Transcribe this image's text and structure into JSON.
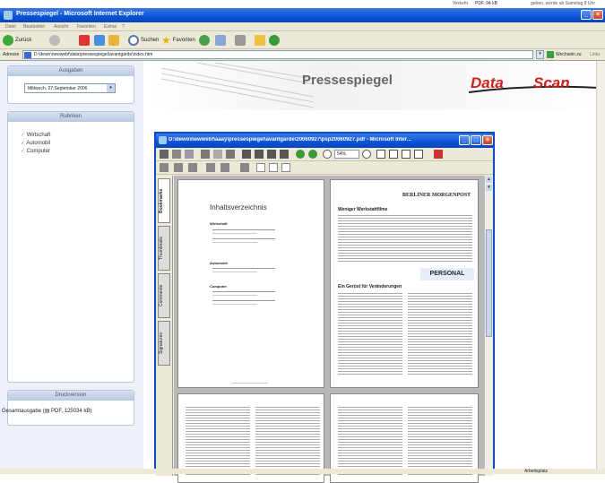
{
  "popup": {
    "verkehr": "Verkehr",
    "pdf_link": "PDF, 94 kB",
    "right_text": "geben, werde ab Samstag 8 Uhr"
  },
  "window": {
    "title": "Pressespiegel - Microsoft Internet Explorer"
  },
  "menu": [
    "Datei",
    "Bearbeiten",
    "Ansicht",
    "Favoriten",
    "Extras",
    "?"
  ],
  "toolbar": {
    "back": "Zurück",
    "search": "Suchen",
    "favorites": "Favoriten"
  },
  "address": {
    "label": "Adresse",
    "url": "D:\\dewo\\newwebf\\data\\pressespiegel\\avantgarde\\index.htm",
    "go": "Wechseln zu",
    "links": "Links"
  },
  "sidebar": {
    "ausgaben_title": "Ausgaben",
    "date_value": "Mittwoch, 27.September 2006",
    "rubriken_title": "Rubriken",
    "rubriken": [
      "Wirtschaft",
      "Automobil",
      "Computer"
    ],
    "druck_title": "Druckversion",
    "gesamt_label": "Gesamtausgabe",
    "gesamt_link": "PDF, 125034 kB"
  },
  "header": {
    "title": "Pressespiegel",
    "logo_left": "Data",
    "logo_right": "Scan"
  },
  "pdf": {
    "title": "D:\\dewo\\newwebf\\aaay\\pressespiegel\\avantgarde\\20060927\\psp20060927.pdf - Microsoft Inter...",
    "zoom": "54%",
    "side_tabs": [
      "Bookmarks",
      "Thumbnails",
      "Comments",
      "Signatures"
    ],
    "toc_title": "Inhaltsverzeichnis",
    "toc_sections": [
      "Wirtschaft",
      "Automobil",
      "Computer"
    ],
    "newspaper": "BERLINER MORGENPOST",
    "headline1": "Weniger Werkstattfilme",
    "headline2": "Ein Gerüst für Veränderungen",
    "personal_logo": "PERSONAL"
  },
  "statusbar": {
    "zone": "Arbeitsplatz"
  }
}
